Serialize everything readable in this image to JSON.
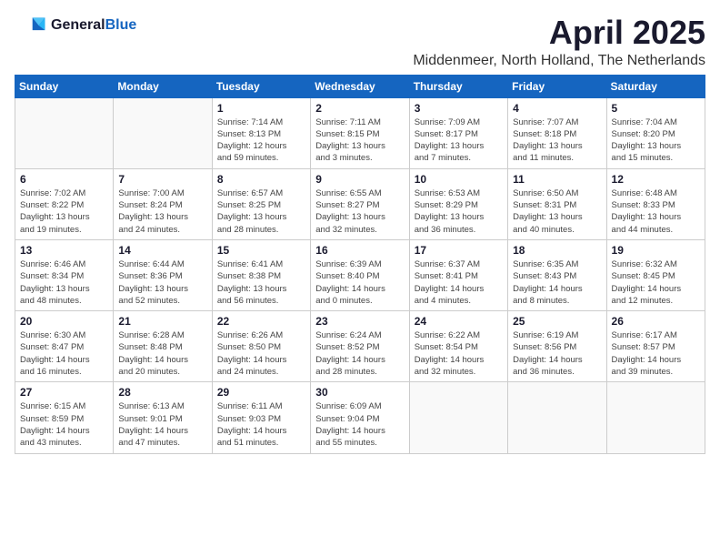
{
  "logo": {
    "general": "General",
    "blue": "Blue"
  },
  "title": {
    "month": "April 2025",
    "location": "Middenmeer, North Holland, The Netherlands"
  },
  "weekdays": [
    "Sunday",
    "Monday",
    "Tuesday",
    "Wednesday",
    "Thursday",
    "Friday",
    "Saturday"
  ],
  "weeks": [
    [
      {
        "day": "",
        "info": ""
      },
      {
        "day": "",
        "info": ""
      },
      {
        "day": "1",
        "info": "Sunrise: 7:14 AM\nSunset: 8:13 PM\nDaylight: 12 hours\nand 59 minutes."
      },
      {
        "day": "2",
        "info": "Sunrise: 7:11 AM\nSunset: 8:15 PM\nDaylight: 13 hours\nand 3 minutes."
      },
      {
        "day": "3",
        "info": "Sunrise: 7:09 AM\nSunset: 8:17 PM\nDaylight: 13 hours\nand 7 minutes."
      },
      {
        "day": "4",
        "info": "Sunrise: 7:07 AM\nSunset: 8:18 PM\nDaylight: 13 hours\nand 11 minutes."
      },
      {
        "day": "5",
        "info": "Sunrise: 7:04 AM\nSunset: 8:20 PM\nDaylight: 13 hours\nand 15 minutes."
      }
    ],
    [
      {
        "day": "6",
        "info": "Sunrise: 7:02 AM\nSunset: 8:22 PM\nDaylight: 13 hours\nand 19 minutes."
      },
      {
        "day": "7",
        "info": "Sunrise: 7:00 AM\nSunset: 8:24 PM\nDaylight: 13 hours\nand 24 minutes."
      },
      {
        "day": "8",
        "info": "Sunrise: 6:57 AM\nSunset: 8:25 PM\nDaylight: 13 hours\nand 28 minutes."
      },
      {
        "day": "9",
        "info": "Sunrise: 6:55 AM\nSunset: 8:27 PM\nDaylight: 13 hours\nand 32 minutes."
      },
      {
        "day": "10",
        "info": "Sunrise: 6:53 AM\nSunset: 8:29 PM\nDaylight: 13 hours\nand 36 minutes."
      },
      {
        "day": "11",
        "info": "Sunrise: 6:50 AM\nSunset: 8:31 PM\nDaylight: 13 hours\nand 40 minutes."
      },
      {
        "day": "12",
        "info": "Sunrise: 6:48 AM\nSunset: 8:33 PM\nDaylight: 13 hours\nand 44 minutes."
      }
    ],
    [
      {
        "day": "13",
        "info": "Sunrise: 6:46 AM\nSunset: 8:34 PM\nDaylight: 13 hours\nand 48 minutes."
      },
      {
        "day": "14",
        "info": "Sunrise: 6:44 AM\nSunset: 8:36 PM\nDaylight: 13 hours\nand 52 minutes."
      },
      {
        "day": "15",
        "info": "Sunrise: 6:41 AM\nSunset: 8:38 PM\nDaylight: 13 hours\nand 56 minutes."
      },
      {
        "day": "16",
        "info": "Sunrise: 6:39 AM\nSunset: 8:40 PM\nDaylight: 14 hours\nand 0 minutes."
      },
      {
        "day": "17",
        "info": "Sunrise: 6:37 AM\nSunset: 8:41 PM\nDaylight: 14 hours\nand 4 minutes."
      },
      {
        "day": "18",
        "info": "Sunrise: 6:35 AM\nSunset: 8:43 PM\nDaylight: 14 hours\nand 8 minutes."
      },
      {
        "day": "19",
        "info": "Sunrise: 6:32 AM\nSunset: 8:45 PM\nDaylight: 14 hours\nand 12 minutes."
      }
    ],
    [
      {
        "day": "20",
        "info": "Sunrise: 6:30 AM\nSunset: 8:47 PM\nDaylight: 14 hours\nand 16 minutes."
      },
      {
        "day": "21",
        "info": "Sunrise: 6:28 AM\nSunset: 8:48 PM\nDaylight: 14 hours\nand 20 minutes."
      },
      {
        "day": "22",
        "info": "Sunrise: 6:26 AM\nSunset: 8:50 PM\nDaylight: 14 hours\nand 24 minutes."
      },
      {
        "day": "23",
        "info": "Sunrise: 6:24 AM\nSunset: 8:52 PM\nDaylight: 14 hours\nand 28 minutes."
      },
      {
        "day": "24",
        "info": "Sunrise: 6:22 AM\nSunset: 8:54 PM\nDaylight: 14 hours\nand 32 minutes."
      },
      {
        "day": "25",
        "info": "Sunrise: 6:19 AM\nSunset: 8:56 PM\nDaylight: 14 hours\nand 36 minutes."
      },
      {
        "day": "26",
        "info": "Sunrise: 6:17 AM\nSunset: 8:57 PM\nDaylight: 14 hours\nand 39 minutes."
      }
    ],
    [
      {
        "day": "27",
        "info": "Sunrise: 6:15 AM\nSunset: 8:59 PM\nDaylight: 14 hours\nand 43 minutes."
      },
      {
        "day": "28",
        "info": "Sunrise: 6:13 AM\nSunset: 9:01 PM\nDaylight: 14 hours\nand 47 minutes."
      },
      {
        "day": "29",
        "info": "Sunrise: 6:11 AM\nSunset: 9:03 PM\nDaylight: 14 hours\nand 51 minutes."
      },
      {
        "day": "30",
        "info": "Sunrise: 6:09 AM\nSunset: 9:04 PM\nDaylight: 14 hours\nand 55 minutes."
      },
      {
        "day": "",
        "info": ""
      },
      {
        "day": "",
        "info": ""
      },
      {
        "day": "",
        "info": ""
      }
    ]
  ]
}
